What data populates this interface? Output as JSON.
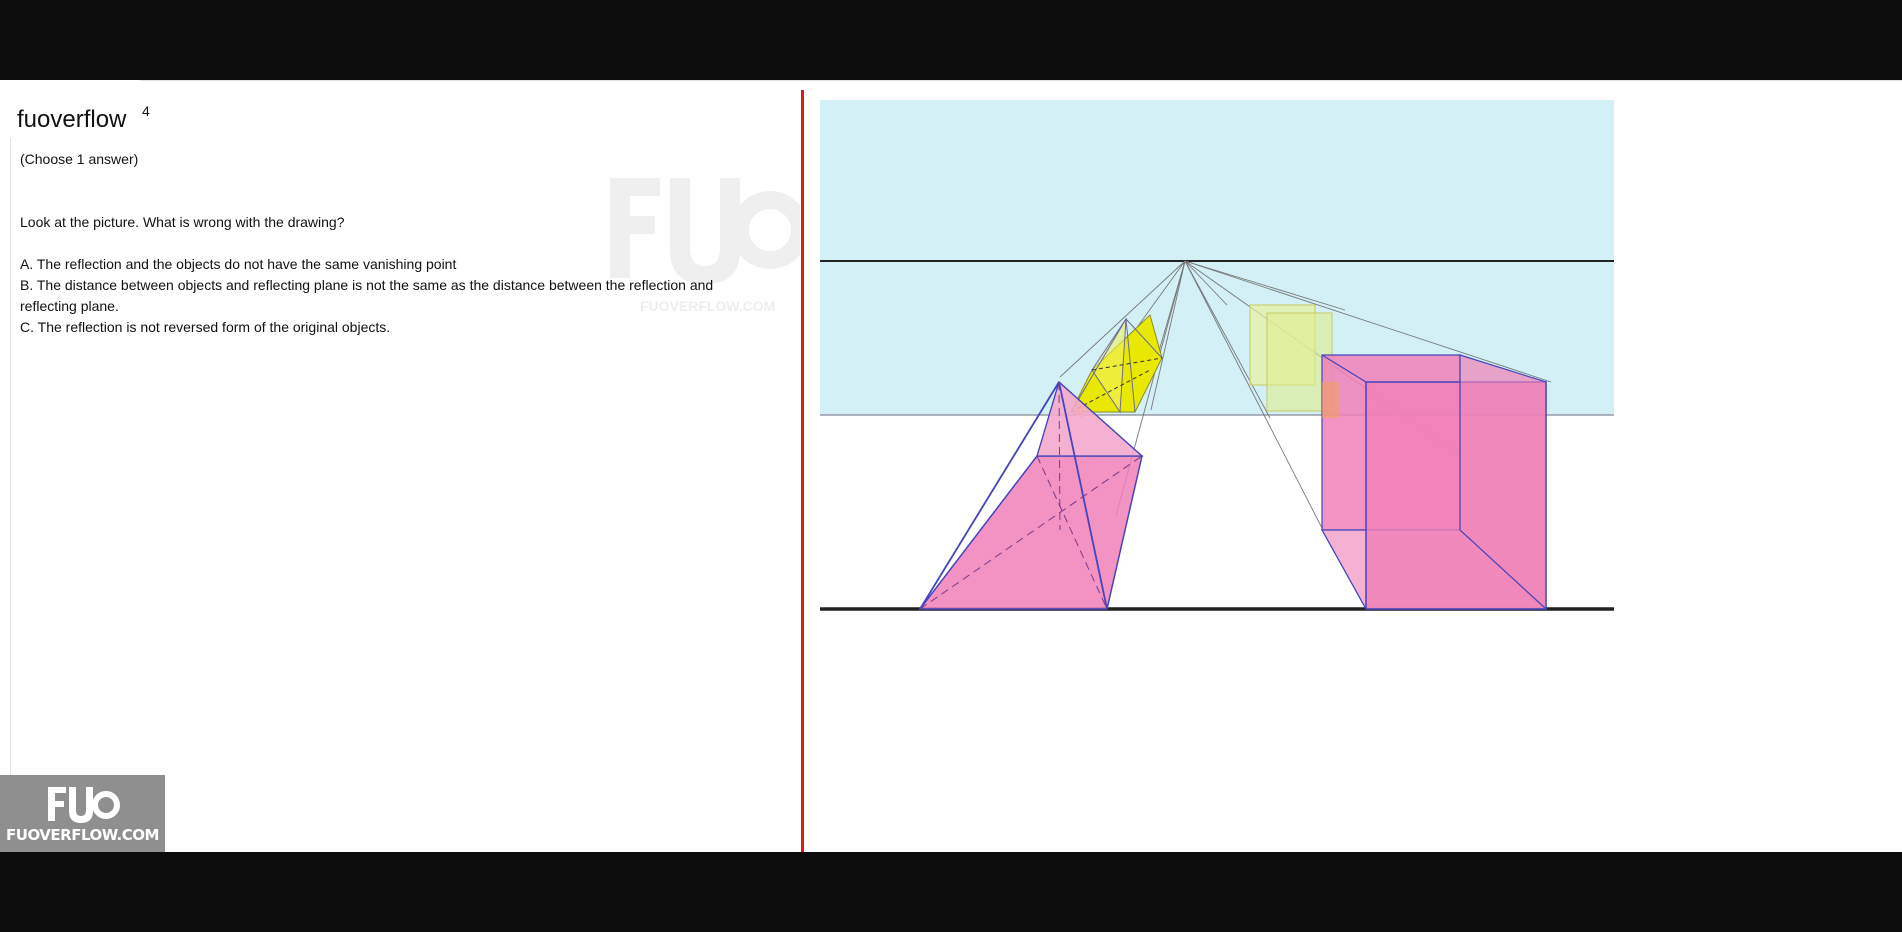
{
  "app": {
    "site_title": "fuoverflow",
    "question_number": "4"
  },
  "question": {
    "instruction": "(Choose 1 answer)",
    "prompt": "Look at the picture. What is wrong with the drawing?",
    "options": [
      "A. The reflection and the objects do not have the same vanishing point",
      "B. The distance between objects and reflecting plane is not the same as the distance between the reflection and",
      "reflecting plane.",
      "C. The reflection is not reversed form of the original objects."
    ]
  },
  "branding": {
    "badge_logo": "FUO",
    "badge_url": "FUOVERFLOW.COM",
    "watermark_url": "FUOVERFLOW.COM"
  },
  "colors": {
    "sky": "#d3f0f6",
    "divider": "#e01818",
    "pink_fill": "#f080b8",
    "yellow_fill": "#e8e800",
    "outline_blue": "#4444bb"
  }
}
